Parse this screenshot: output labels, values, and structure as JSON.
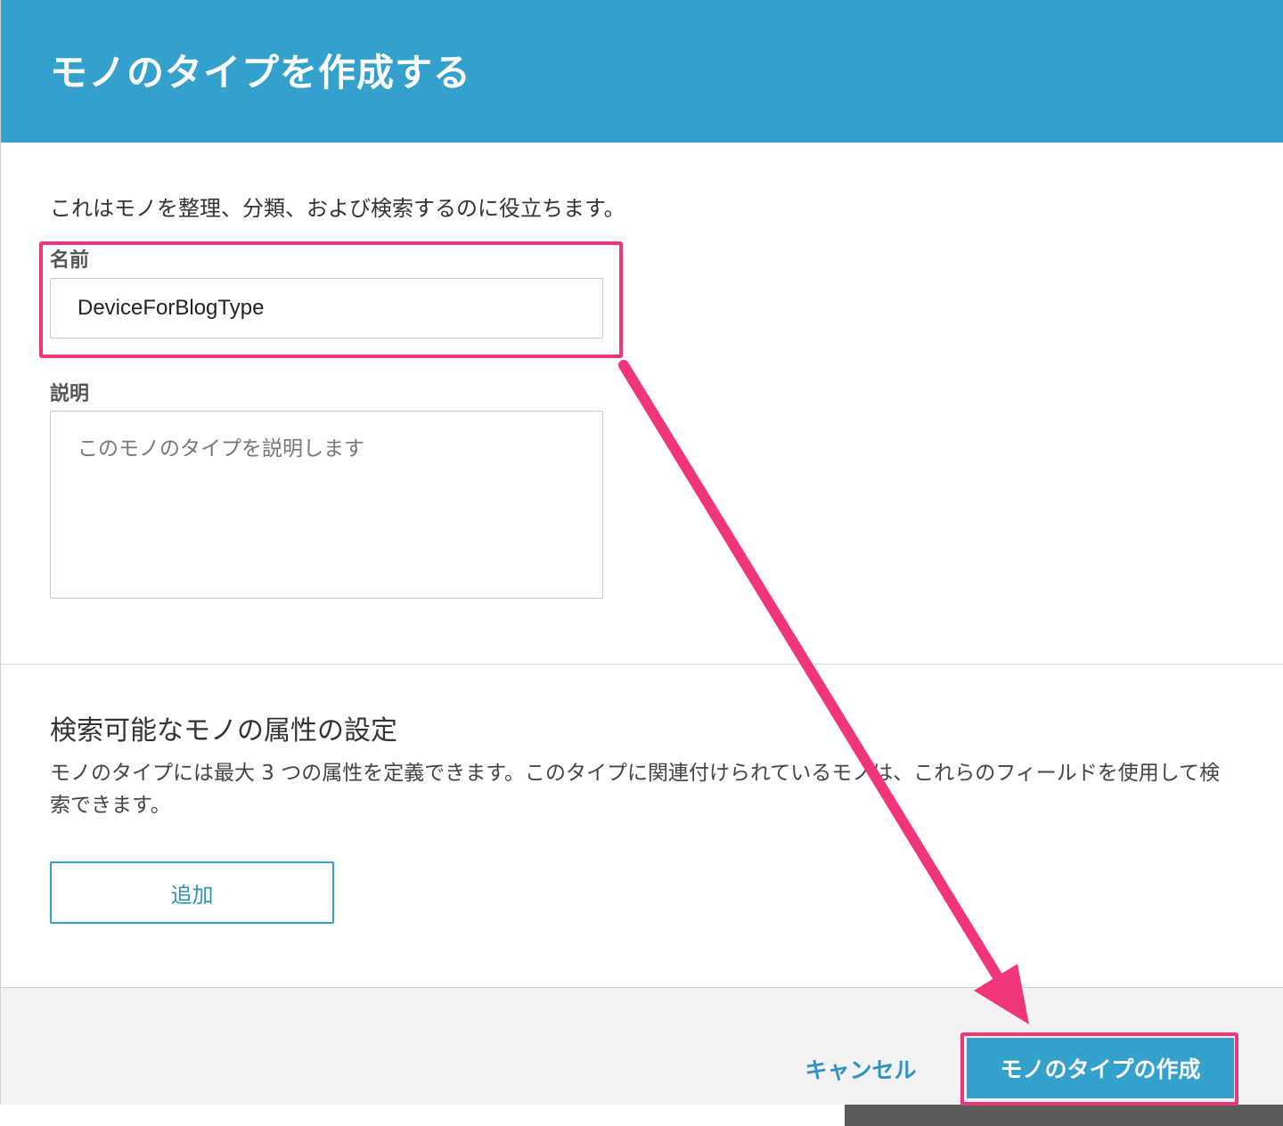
{
  "dialog": {
    "title": "モノのタイプを作成する",
    "intro": "これはモノを整理、分類、および検索するのに役立ちます。",
    "name_field": {
      "label": "名前",
      "value": "DeviceForBlogType"
    },
    "description_field": {
      "label": "説明",
      "placeholder": "このモノのタイプを説明します"
    },
    "searchable_attributes": {
      "title": "検索可能なモノの属性の設定",
      "description": "モノのタイプには最大 3 つの属性を定義できます。このタイプに関連付けられているモノは、これらのフィールドを使用して検索できます。",
      "add_label": "追加"
    },
    "footer": {
      "cancel_label": "キャンセル",
      "create_label": "モノのタイプの作成"
    }
  },
  "colors": {
    "header_bg": "#34a0cc",
    "accent": "#34a0cc",
    "annotation": "#f0357a"
  }
}
